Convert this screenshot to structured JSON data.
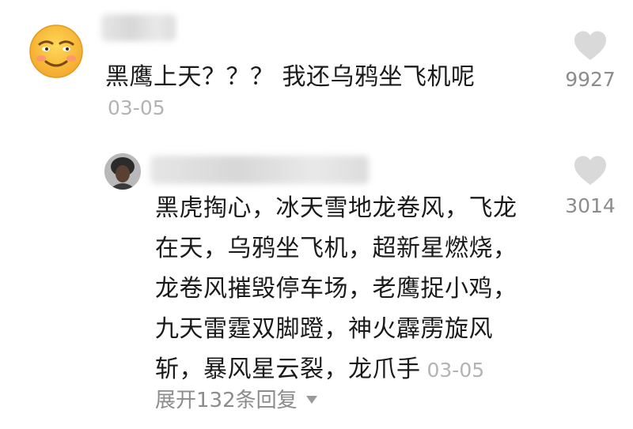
{
  "comment": {
    "text": "黑鹰上天？？？ 我还乌鸦坐飞机呢",
    "date": "03-05",
    "likes": "9927",
    "avatar_icon": "smiley-face-icon"
  },
  "reply": {
    "lines": [
      "黑虎掏心，冰天雪地龙卷风，飞龙",
      "在天，乌鸦坐飞机，超新星燃烧，",
      "龙卷风摧毁停车场，老鹰捉小鸡，",
      "九天雷霆双脚蹬，神火霹雳旋风",
      "斩，暴风星云裂，龙爪手"
    ],
    "date": "03-05",
    "likes": "3014"
  },
  "expand_label": "展开132条回复",
  "colors": {
    "text": "#1a1a1a",
    "muted": "#b3b3b3",
    "count": "#8c8c8c",
    "heart": "#d9d9d9"
  }
}
